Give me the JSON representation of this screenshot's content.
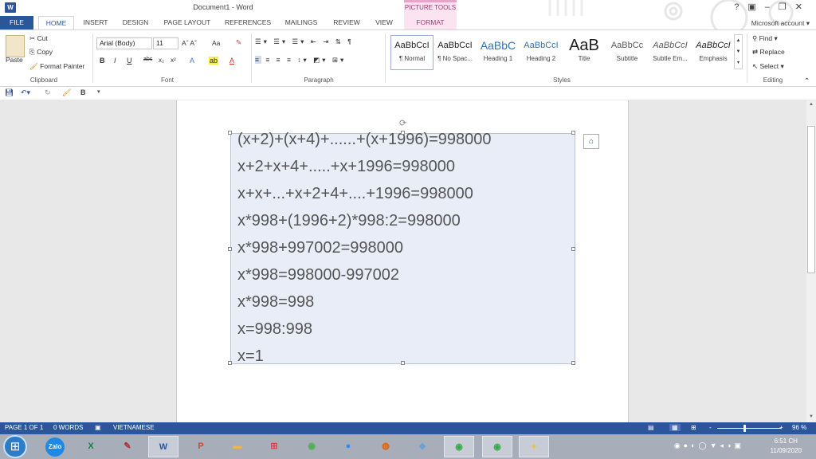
{
  "window": {
    "title": "Document1 - Word",
    "contextual_tab_group": "PICTURE TOOLS",
    "account": "Microsoft account"
  },
  "tabs": [
    "FILE",
    "HOME",
    "INSERT",
    "DESIGN",
    "PAGE LAYOUT",
    "REFERENCES",
    "MAILINGS",
    "REVIEW",
    "VIEW",
    "FORMAT"
  ],
  "active_tab": "HOME",
  "ribbon": {
    "clipboard": {
      "label": "Clipboard",
      "paste": "Paste",
      "cut": "Cut",
      "copy": "Copy",
      "format_painter": "Format Painter"
    },
    "font": {
      "label": "Font",
      "name": "Arial (Body)",
      "size": "11",
      "case": "Aa"
    },
    "paragraph": {
      "label": "Paragraph"
    },
    "styles": {
      "label": "Styles",
      "items": [
        {
          "preview": "AaBbCcI",
          "name": "¶ Normal"
        },
        {
          "preview": "AaBbCcI",
          "name": "¶ No Spac..."
        },
        {
          "preview": "AaBbC",
          "name": "Heading 1"
        },
        {
          "preview": "AaBbCcI",
          "name": "Heading 2"
        },
        {
          "preview": "AaB",
          "name": "Title"
        },
        {
          "preview": "AaBbCc",
          "name": "Subtitle"
        },
        {
          "preview": "AaBbCcI",
          "name": "Subtle Em..."
        },
        {
          "preview": "AaBbCcI",
          "name": "Emphasis"
        }
      ]
    },
    "editing": {
      "label": "Editing",
      "find": "Find",
      "replace": "Replace",
      "select": "Select"
    }
  },
  "document": {
    "equations": [
      "(x+2)+(x+4)+......+(x+1996)=998000",
      "x+2+x+4+.....+x+1996=998000",
      "x+x+...+x+2+4+....+1996=998000",
      "x*998+(1996+2)*998:2=998000",
      "x*998+997002=998000",
      "x*998=998000-997002",
      "x*998=998",
      "x=998:998",
      "x=1"
    ]
  },
  "status": {
    "page": "PAGE 1 OF 1",
    "words": "0 WORDS",
    "language": "VIETNAMESE",
    "zoom": "96 %",
    "zoom_minus": "-",
    "zoom_plus": "+"
  },
  "taskbar": {
    "zalo": "Zalo",
    "time": "6:51 CH",
    "date": "11/09/2020"
  },
  "colors": {
    "accent": "#2b579a",
    "picture_tools": "#a33a74",
    "image_bg": "#e8edf7"
  }
}
